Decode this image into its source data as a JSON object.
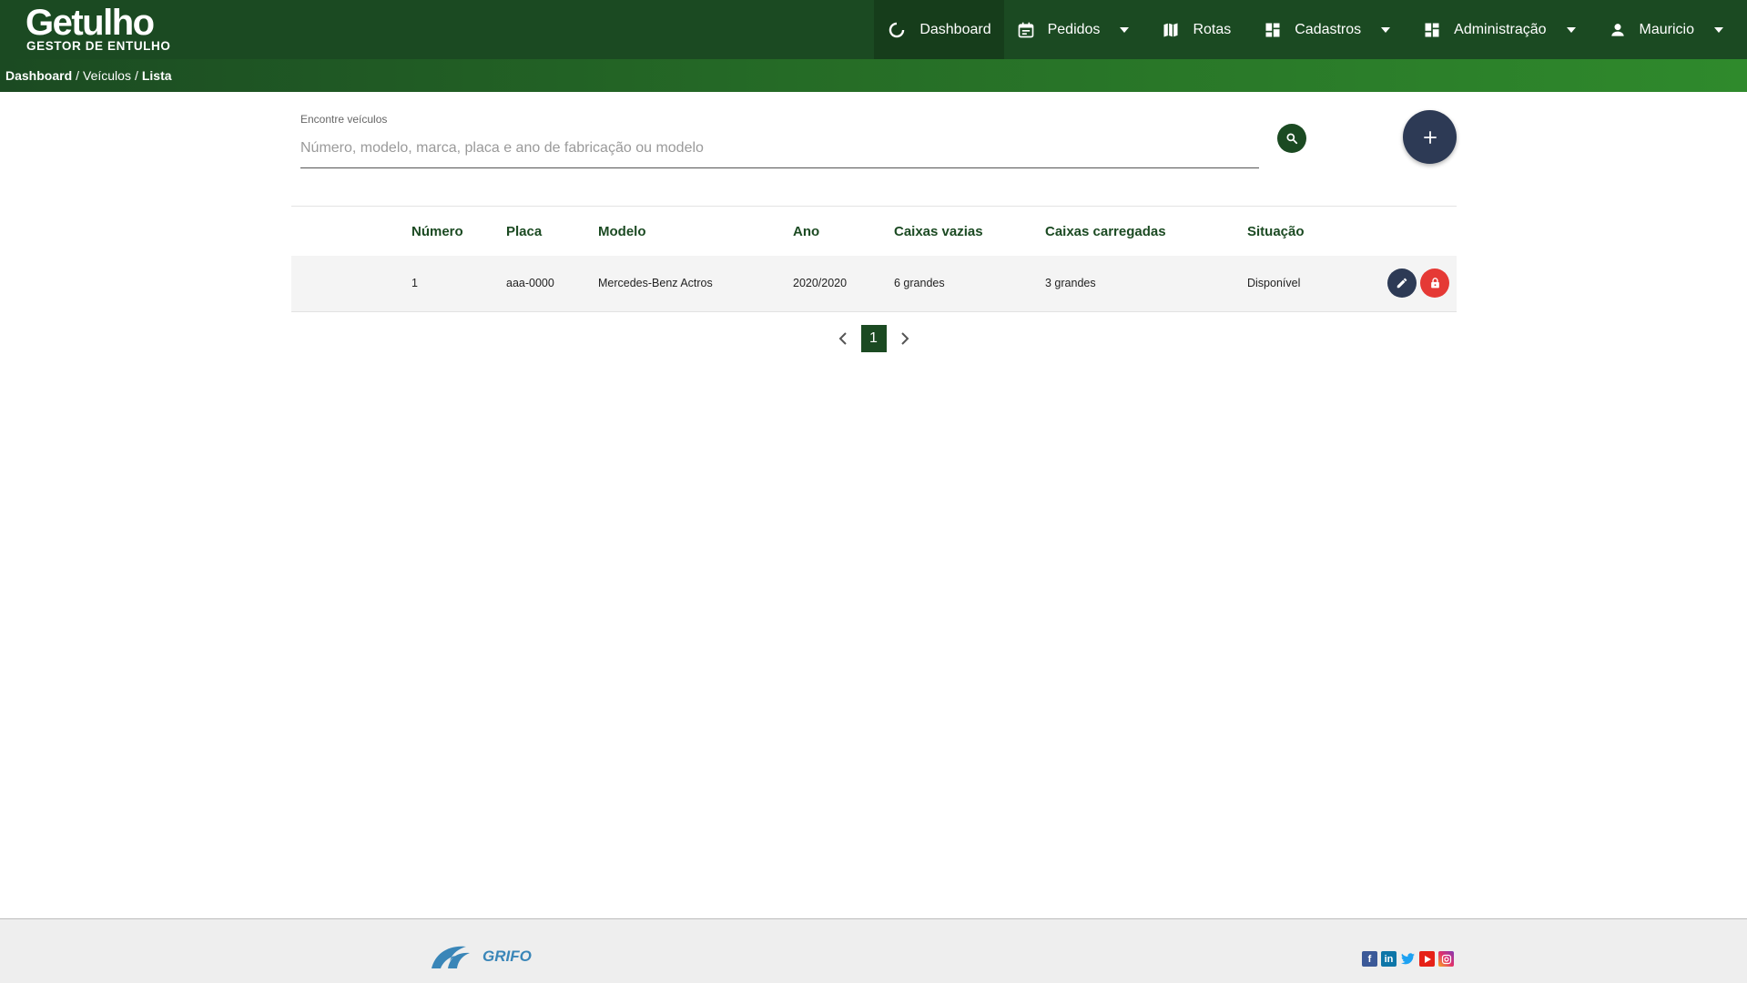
{
  "app": {
    "logo_title": "Getulho",
    "logo_subtitle": "GESTOR DE ENTULHO"
  },
  "nav": {
    "items": [
      {
        "label": "Dashboard",
        "icon": "refresh-circle-icon",
        "active": true
      },
      {
        "label": "Pedidos",
        "icon": "calendar-icon",
        "dropdown": true
      },
      {
        "label": "Rotas",
        "icon": "map-icon"
      },
      {
        "label": "Cadastros",
        "icon": "dashboard-grid-icon",
        "dropdown": true
      },
      {
        "label": "Administração",
        "icon": "dashboard-grid-icon",
        "dropdown": true
      },
      {
        "label": "Mauricio",
        "icon": "person-icon",
        "dropdown": true
      }
    ]
  },
  "breadcrumb": {
    "items": [
      "Dashboard",
      "Veículos",
      "Lista"
    ]
  },
  "search": {
    "label": "Encontre veículos",
    "placeholder": "Número, modelo, marca, placa e ano de fabricação ou modelo",
    "value": ""
  },
  "table": {
    "columns": [
      "Número",
      "Placa",
      "Modelo",
      "Ano",
      "Caixas vazias",
      "Caixas carregadas",
      "Situação"
    ],
    "rows": [
      {
        "numero": "1",
        "placa": "aaa-0000",
        "modelo": "Mercedes-Benz Actros",
        "ano": "2020/2020",
        "caixas_vazias": "6 grandes",
        "caixas_carregadas": "3 grandes",
        "situacao": "Disponível"
      }
    ]
  },
  "pagination": {
    "current_page": "1"
  },
  "footer": {
    "brand": "GRIFO",
    "social": [
      "facebook-icon",
      "linkedin-icon",
      "twitter-icon",
      "youtube-icon",
      "instagram-icon"
    ]
  },
  "colors": {
    "primary_green": "#1b4a22",
    "accent_navy": "#2d3a55",
    "danger_red": "#e53935"
  }
}
